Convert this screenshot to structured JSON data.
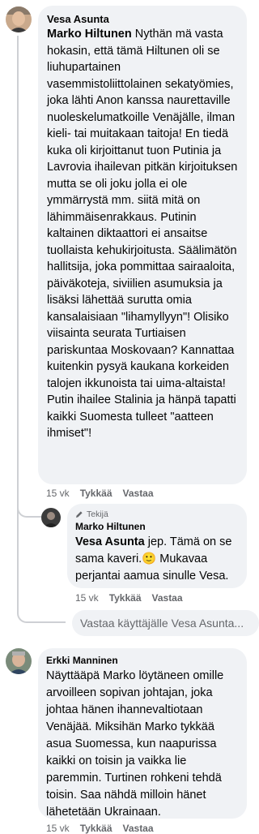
{
  "comments": [
    {
      "author": "Vesa Asunta",
      "mention": "Marko Hiltunen",
      "text": " Nythän mä vasta hokasin, että tämä Hiltunen oli se liuhupartainen vasemmistoliittolainen sekatyömies, joka lähti Anon kanssa naurettaville nuoleskelumatkoille Venäjälle, ilman kieli- tai muitakaan taitoja! En tiedä kuka oli kirjoittanut tuon Putinia ja Lavrovia ihailevan pitkän kirjoituksen mutta se oli joku jolla ei ole ymmärrystä mm. siitä mitä on lähimmäisenrakkaus. Putinin kaltainen diktaattori ei ansaitse tuollaista kehukirjoitusta. Säälimätön hallitsija, joka pommittaa sairaaloita, päiväkoteja, siviilien asumuksia ja lisäksi lähettää surutta omia kansalaisiaan \"lihamyllyyn\"! Olisiko viisainta seurata Turtiaisen pariskuntaa Moskovaan? Kannattaa kuitenkin pysyä kaukana korkeiden talojen ikkunoista tai uima-altaista! Putin ihailee Stalinia ja hänpä tapatti kaikki Suomesta tulleet \"aatteen ihmiset\"!",
      "time": "15 vk",
      "like": "Tykkää",
      "reply": "Vastaa"
    },
    {
      "badge": "Tekijä",
      "author": "Marko Hiltunen",
      "mention": "Vesa Asunta",
      "text": " jep. Tämä on se sama kaveri.",
      "emoji": "🙂",
      "text2": " Mukavaa perjantai aamua sinulle Vesa.",
      "time": "15 vk",
      "like": "Tykkää",
      "reply": "Vastaa"
    },
    {
      "author": "Erkki Manninen",
      "text": "Näyttääpä Marko löytäneen omille arvoilleen sopivan johtajan, joka johtaa hänen ihannevaltiotaan Venäjää. Miksihän Marko tykkää asua Suomessa, kun naapurissa kaikki on toisin ja vaikka lie paremmin. Turtinen rohkeni tehdä toisin. Saa nähdä milloin hänet lähetetään Ukrainaan.",
      "time": "15 vk",
      "like": "Tykkää",
      "reply": "Vastaa"
    }
  ],
  "reply_box": {
    "placeholder": "Vastaa käyttäjälle Vesa Asunta..."
  }
}
